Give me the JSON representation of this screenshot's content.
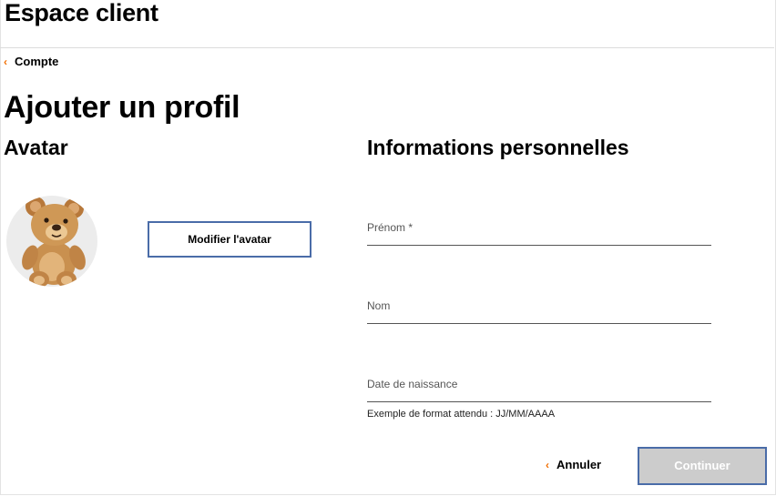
{
  "header": {
    "title": "Espace client"
  },
  "breadcrumb": {
    "icon": "chevron-left-icon",
    "label": "Compte"
  },
  "page": {
    "title": "Ajouter un profil"
  },
  "avatar_section": {
    "title": "Avatar",
    "image": "teddy-bear-avatar",
    "modify_button": "Modifier l'avatar"
  },
  "info_section": {
    "title": "Informations personnelles",
    "fields": [
      {
        "label": "Prénom *",
        "value": ""
      },
      {
        "label": "Nom",
        "value": ""
      },
      {
        "label": "Date de naissance",
        "value": ""
      }
    ],
    "date_hint": "Exemple de format attendu : JJ/MM/AAAA"
  },
  "actions": {
    "cancel_label": "Annuler",
    "continue_label": "Continuer",
    "continue_state": "disabled"
  },
  "colors": {
    "accent": "#f16e00",
    "button_border": "#4a6ca8",
    "disabled_button_bg": "#cccccc"
  }
}
